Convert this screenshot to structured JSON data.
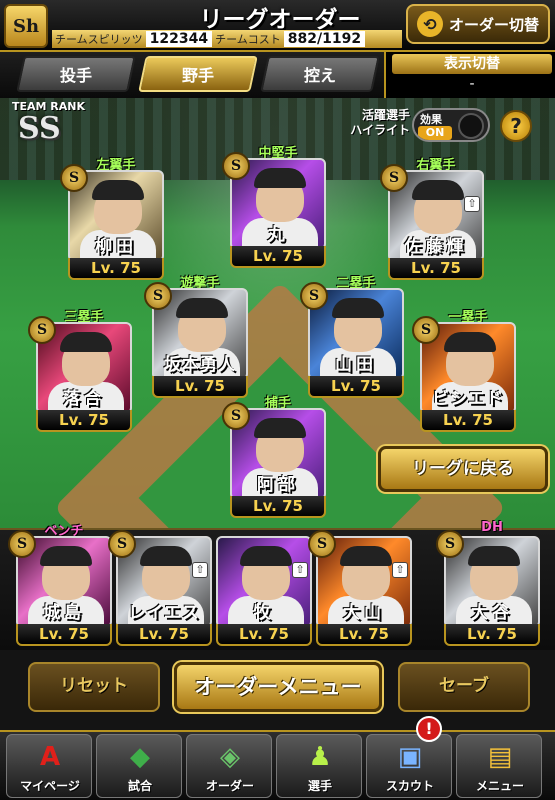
{
  "header": {
    "logo": "Sh",
    "title": "リーグオーダー",
    "team_spirit_label": "チームスピリッツ",
    "team_spirit_value": "122344",
    "team_cost_label": "チームコスト",
    "team_cost_value": "882/1192",
    "order_switch_label": "オーダー切替",
    "order_switch_icon": "swap-arrows-icon"
  },
  "tabs": [
    {
      "label": "投手",
      "active": false
    },
    {
      "label": "野手",
      "active": true
    },
    {
      "label": "控え",
      "active": false
    }
  ],
  "display_toggle": {
    "title": "表示切替",
    "value": "-"
  },
  "team_rank": {
    "label": "TEAM RANK",
    "value": "SS"
  },
  "highlight": {
    "label_line1": "活躍選手",
    "label_line2": "ハイライト",
    "effect_label": "効果",
    "effect_state": "ON"
  },
  "field_players": [
    {
      "position": "左翼手",
      "name": "柳田",
      "level": "Lv. 75",
      "rarity": "S",
      "upgrade": false
    },
    {
      "position": "中堅手",
      "name": "丸",
      "level": "Lv. 75",
      "rarity": "S",
      "upgrade": false
    },
    {
      "position": "右翼手",
      "name": "佐藤輝",
      "level": "Lv. 75",
      "rarity": "S",
      "upgrade": true
    },
    {
      "position": "遊撃手",
      "name": "坂本勇人",
      "level": "Lv. 75",
      "rarity": "S",
      "upgrade": false
    },
    {
      "position": "二塁手",
      "name": "山田",
      "level": "Lv. 75",
      "rarity": "S",
      "upgrade": false
    },
    {
      "position": "三塁手",
      "name": "落合",
      "level": "Lv. 75",
      "rarity": "S",
      "upgrade": false
    },
    {
      "position": "一塁手",
      "name": "ビシエド",
      "level": "Lv. 75",
      "rarity": "S",
      "upgrade": false
    },
    {
      "position": "捕手",
      "name": "阿部",
      "level": "Lv. 75",
      "rarity": "S",
      "upgrade": false
    }
  ],
  "back_to_league_label": "リーグに戻る",
  "bench": {
    "label": "ベンチ",
    "dh_label": "DH",
    "players": [
      {
        "name": "城島",
        "level": "Lv. 75",
        "rarity": "S",
        "upgrade": false
      },
      {
        "name": "レイエス",
        "level": "Lv. 75",
        "rarity": "S",
        "upgrade": true
      },
      {
        "name": "牧",
        "level": "Lv. 75",
        "rarity": "",
        "upgrade": true
      },
      {
        "name": "大山",
        "level": "Lv. 75",
        "rarity": "S",
        "upgrade": true
      },
      {
        "name": "大谷",
        "level": "Lv. 75",
        "rarity": "S",
        "upgrade": false
      }
    ]
  },
  "actions": {
    "reset": "リセット",
    "order_menu": "オーダーメニュー",
    "save": "セーブ"
  },
  "nav": [
    {
      "label": "マイページ",
      "icon": "a-logo-icon"
    },
    {
      "label": "試合",
      "icon": "stadium-icon"
    },
    {
      "label": "オーダー",
      "icon": "field-icon"
    },
    {
      "label": "選手",
      "icon": "player-silhouette-icon"
    },
    {
      "label": "スカウト",
      "icon": "scout-ticket-icon"
    },
    {
      "label": "メニュー",
      "icon": "mascot-menu-icon"
    }
  ],
  "notification_badge": "!"
}
